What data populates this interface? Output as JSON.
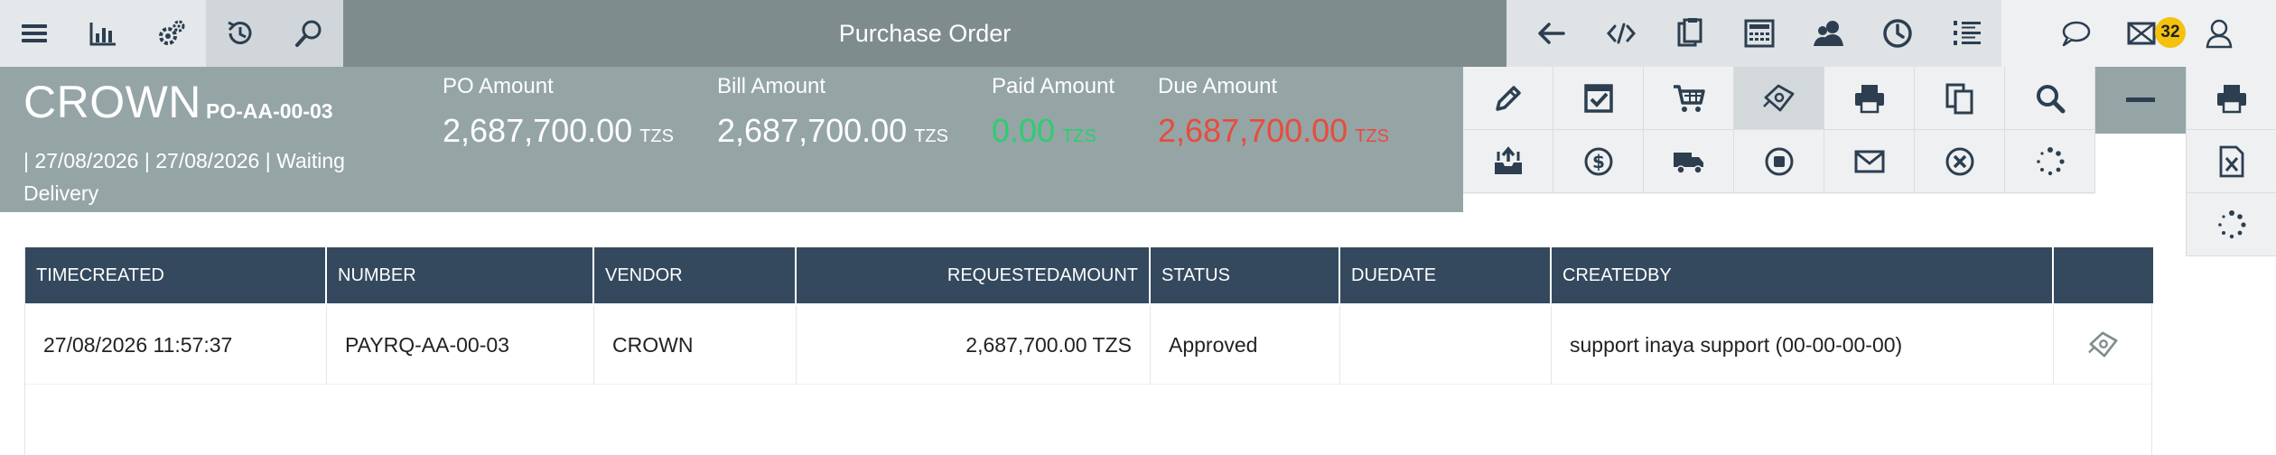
{
  "app": {
    "title": "Purchase Order"
  },
  "toolbar_left": [
    {
      "name": "menu-icon"
    },
    {
      "name": "chart-icon"
    },
    {
      "name": "settings-icon"
    },
    {
      "name": "history-icon"
    },
    {
      "name": "search-icon"
    }
  ],
  "toolbar_right": [
    {
      "name": "back-icon"
    },
    {
      "name": "code-icon"
    },
    {
      "name": "clipboard-icon"
    },
    {
      "name": "calculator-icon"
    },
    {
      "name": "users-icon"
    },
    {
      "name": "clock-icon"
    },
    {
      "name": "list-icon"
    }
  ],
  "notifications": {
    "mail_count": "32"
  },
  "header": {
    "vendor": "CROWN",
    "po_number": "PO-AA-00-03",
    "meta": "| 27/08/2026 | 27/08/2026 | Waiting Delivery",
    "amounts": [
      {
        "label": "PO Amount",
        "value": "2,687,700.00",
        "currency": "TZS",
        "color": "#ffffff"
      },
      {
        "label": "Bill Amount",
        "value": "2,687,700.00",
        "currency": "TZS",
        "color": "#ffffff"
      },
      {
        "label": "Paid Amount",
        "value": "0.00",
        "currency": "TZS",
        "color": "#2ecc71"
      },
      {
        "label": "Due Amount",
        "value": "2,687,700.00",
        "currency": "TZS",
        "color": "#e74c3c"
      }
    ]
  },
  "actions": {
    "row1": [
      "edit-icon",
      "checkbox-icon",
      "cart-icon",
      "payment-request-icon",
      "print-icon",
      "copy-icon",
      "search-icon"
    ],
    "row2": [
      "archive-icon",
      "dollar-icon",
      "truck-icon",
      "stop-icon",
      "mail-icon",
      "cancel-icon",
      "loading-icon"
    ],
    "side": [
      "print-icon",
      "excel-icon",
      "loading-icon"
    ],
    "collapse": "minus-icon"
  },
  "table": {
    "columns": [
      "TIMECREATED",
      "NUMBER",
      "VENDOR",
      "REQUESTEDAMOUNT",
      "STATUS",
      "DUEDATE",
      "CREATEDBY",
      ""
    ],
    "rows": [
      {
        "timecreated": "27/08/2026 11:57:37",
        "number": "PAYRQ-AA-00-03",
        "vendor": "CROWN",
        "requestedamount": "2,687,700.00 TZS",
        "status": "Approved",
        "duedate": "",
        "createdby": "support inaya support (00-00-00-00)",
        "action_icon": "payment-request-icon"
      }
    ]
  },
  "colors": {
    "header_bg": "#95a5a6",
    "topbar_bg": "#7f8c8d",
    "table_header_bg": "#34495e",
    "paid": "#2ecc71",
    "due": "#e74c3c",
    "badge": "#f4c20d"
  }
}
